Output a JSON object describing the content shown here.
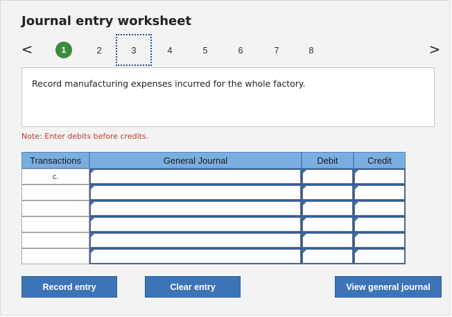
{
  "title": "Journal entry worksheet",
  "nav": {
    "prev_icon": "chevron-left-icon",
    "next_icon": "chevron-right-icon",
    "prev_glyph": "<",
    "next_glyph": ">",
    "steps": [
      "1",
      "2",
      "3",
      "4",
      "5",
      "6",
      "7",
      "8"
    ],
    "active_step": "1",
    "focused_step": "3"
  },
  "instruction": "Record manufacturing expenses incurred for the whole factory.",
  "note": "Note: Enter debits before credits.",
  "table": {
    "headers": {
      "transactions": "Transactions",
      "general_journal": "General Journal",
      "debit": "Debit",
      "credit": "Credit"
    },
    "rows": [
      {
        "transaction": "c."
      },
      {
        "transaction": ""
      },
      {
        "transaction": ""
      },
      {
        "transaction": ""
      },
      {
        "transaction": ""
      },
      {
        "transaction": ""
      }
    ]
  },
  "buttons": {
    "record": "Record entry",
    "clear": "Clear entry",
    "view": "View general journal"
  },
  "colors": {
    "active_step": "#3b8a3e",
    "header_bg": "#7aaee0",
    "button_bg": "#3d74b8",
    "note": "#c0392b"
  }
}
